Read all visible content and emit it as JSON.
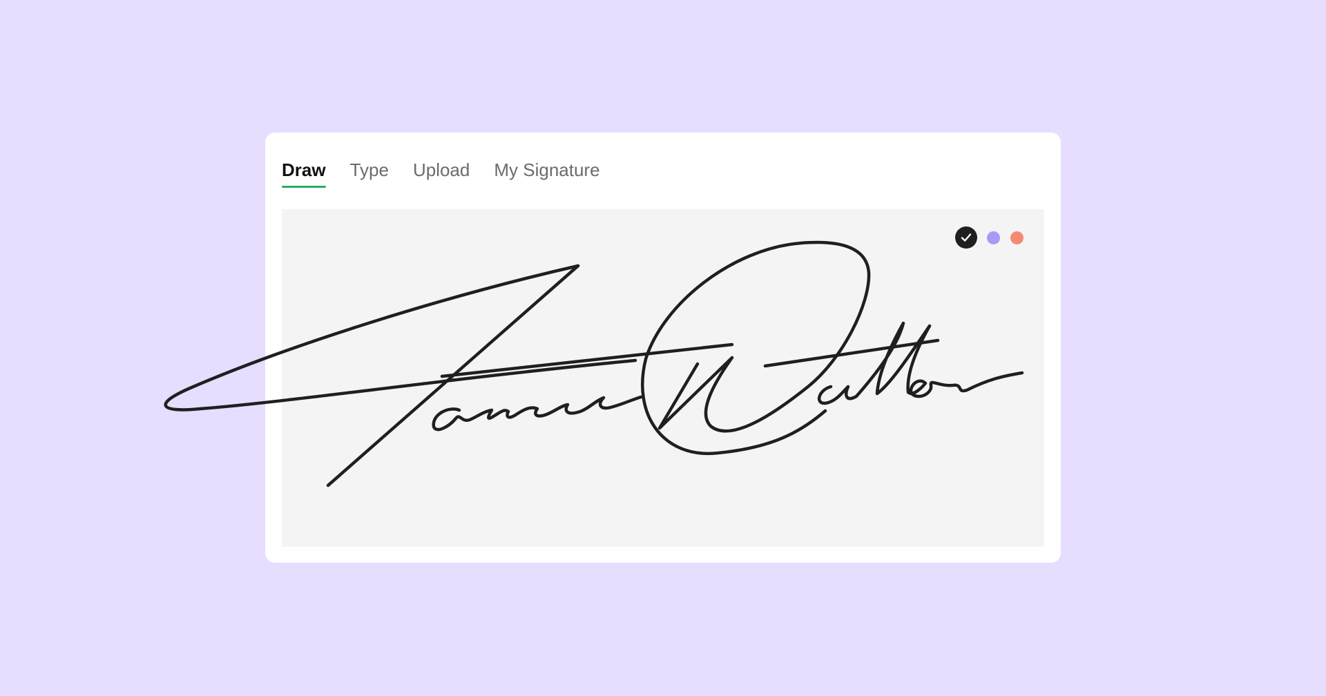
{
  "tabs": [
    {
      "label": "Draw",
      "active": true
    },
    {
      "label": "Type",
      "active": false
    },
    {
      "label": "Upload",
      "active": false
    },
    {
      "label": "My Signature",
      "active": false
    }
  ],
  "accent_color": "#22b064",
  "background_color": "#e6ddff",
  "canvas_color": "#f4f4f4",
  "ink_colors": [
    {
      "name": "black",
      "hex": "#1f1f1f",
      "selected": true,
      "icon": "check-icon"
    },
    {
      "name": "purple",
      "hex": "#a79af7",
      "selected": false
    },
    {
      "name": "coral",
      "hex": "#f58a72",
      "selected": false
    }
  ],
  "signature": {
    "stroke_color": "#1f1f1f"
  }
}
